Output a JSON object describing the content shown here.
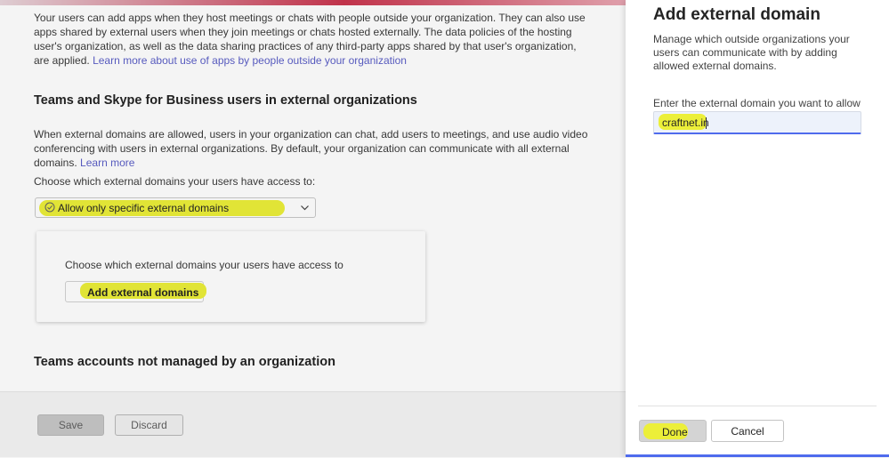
{
  "main": {
    "intro_text": "Your users can add apps when they host meetings or chats with people outside your organization. They can also use apps shared by external users when they join meetings or chats hosted externally. The data policies of the hosting user's organization, as well as the data sharing practices of any third-party apps shared by that user's organization, are applied.",
    "intro_link": "Learn more about use of apps by people outside your organization",
    "section1_title": "Teams and Skype for Business users in external organizations",
    "section1_text": "When external domains are allowed, users in your organization can chat, add users to meetings, and use audio video conferencing with users in external organizations. By default, your organization can communicate with all external domains.",
    "section1_link": "Learn more",
    "choose_label": "Choose which external domains your users have access to:",
    "dropdown_value": "Allow only specific external domains",
    "card_label": "Choose which external domains your users have access to",
    "add_domains_label": "Add external domains",
    "section2_title": "Teams accounts not managed by an organization"
  },
  "footer": {
    "save_label": "Save",
    "discard_label": "Discard"
  },
  "panel": {
    "title": "Add external domain",
    "description": "Manage which outside organizations your users can communicate with by adding allowed external domains.",
    "field_label": "Enter the external domain you want to allow",
    "field_value": "craftnet.in",
    "done_label": "Done",
    "cancel_label": "Cancel"
  },
  "colors": {
    "highlight": "#ecef39",
    "accent": "#4f6bed",
    "link": "#5b5fc7"
  }
}
